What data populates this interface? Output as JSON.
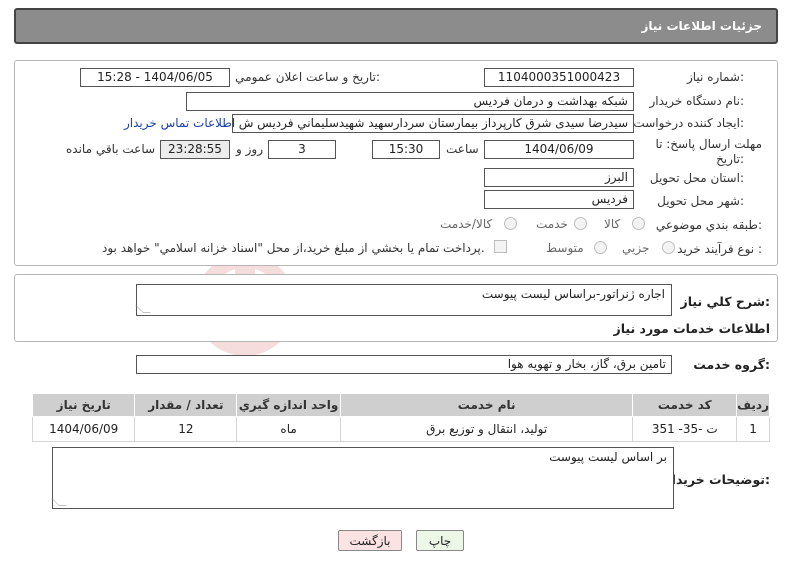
{
  "header": {
    "title": "جزئيات اطلاعات نياز"
  },
  "form": {
    "need_number": {
      "label": "شماره نياز:",
      "value": "1104000351000423"
    },
    "announce_datetime": {
      "label": "تاريخ و ساعت اعلان عمومي:",
      "value": "1404/06/05 - 15:28"
    },
    "buyer_org": {
      "label": "نام دستگاه خريدار:",
      "value": "شبکه بهداشت و درمان فرديس"
    },
    "requester": {
      "label": "ايجاد کننده درخواست:",
      "value": "سيدرضا سيدى شرق کارپرداز بيمارستان سردارسهيد شهيدسليماني فرديس ش"
    },
    "contact_link": "اطلاعات تماس خريدار",
    "deadline": {
      "label_line1": "مهلت ارسال پاسخ: تا",
      "label_line2": "تاريخ:",
      "date": "1404/06/09",
      "time_label": "ساعت",
      "time": "15:30",
      "days": "3",
      "days_label": "روز و",
      "remaining": "23:28:55",
      "remaining_label": "ساعت باقي مانده"
    },
    "province": {
      "label": "استان محل تحويل:",
      "value": "البرز"
    },
    "city": {
      "label": "شهر محل تحويل:",
      "value": "فرديس"
    },
    "category": {
      "label": "طبقه بندي موضوعي:",
      "options": [
        "کالا",
        "خدمت",
        "کالا/خدمت"
      ]
    },
    "process": {
      "label": "نوع فرآيند خريد :",
      "options": [
        "جزيي",
        "متوسط"
      ],
      "payment_note": "پرداخت تمام يا بخشي از مبلغ خريد،از محل \"اسناد خزانه اسلامي\" خواهد بود."
    }
  },
  "summary": {
    "label": "شرح کلي نياز:",
    "value": "اجاره ژنراتور-براساس ليست پيوست"
  },
  "services_heading": "اطلاعات خدمات مورد نياز",
  "service_group": {
    "label": "گروه خدمت:",
    "value": "تامين برق، گاز، بخار و تهويه هوا"
  },
  "table": {
    "headers": [
      "رديف",
      "کد خدمت",
      "نام خدمت",
      "واحد اندازه گيري",
      "تعداد / مقدار",
      "تاريخ نياز"
    ],
    "rows": [
      {
        "row": "1",
        "code": "ت -35- 351",
        "name": "توليد، انتقال و توزيع برق",
        "unit": "ماه",
        "qty": "12",
        "date": "1404/06/09"
      }
    ]
  },
  "buyer_notes": {
    "label": "توضيحات خريدار:",
    "value": "بر اساس ليست پيوست"
  },
  "buttons": {
    "print": "چاپ",
    "back": "بازگشت"
  },
  "colors": {
    "header_bg": "#8c8c8c",
    "back_button_bg": "#fbe3e3",
    "print_button_bg": "#ecf7e8",
    "link": "#1a3fb0"
  }
}
